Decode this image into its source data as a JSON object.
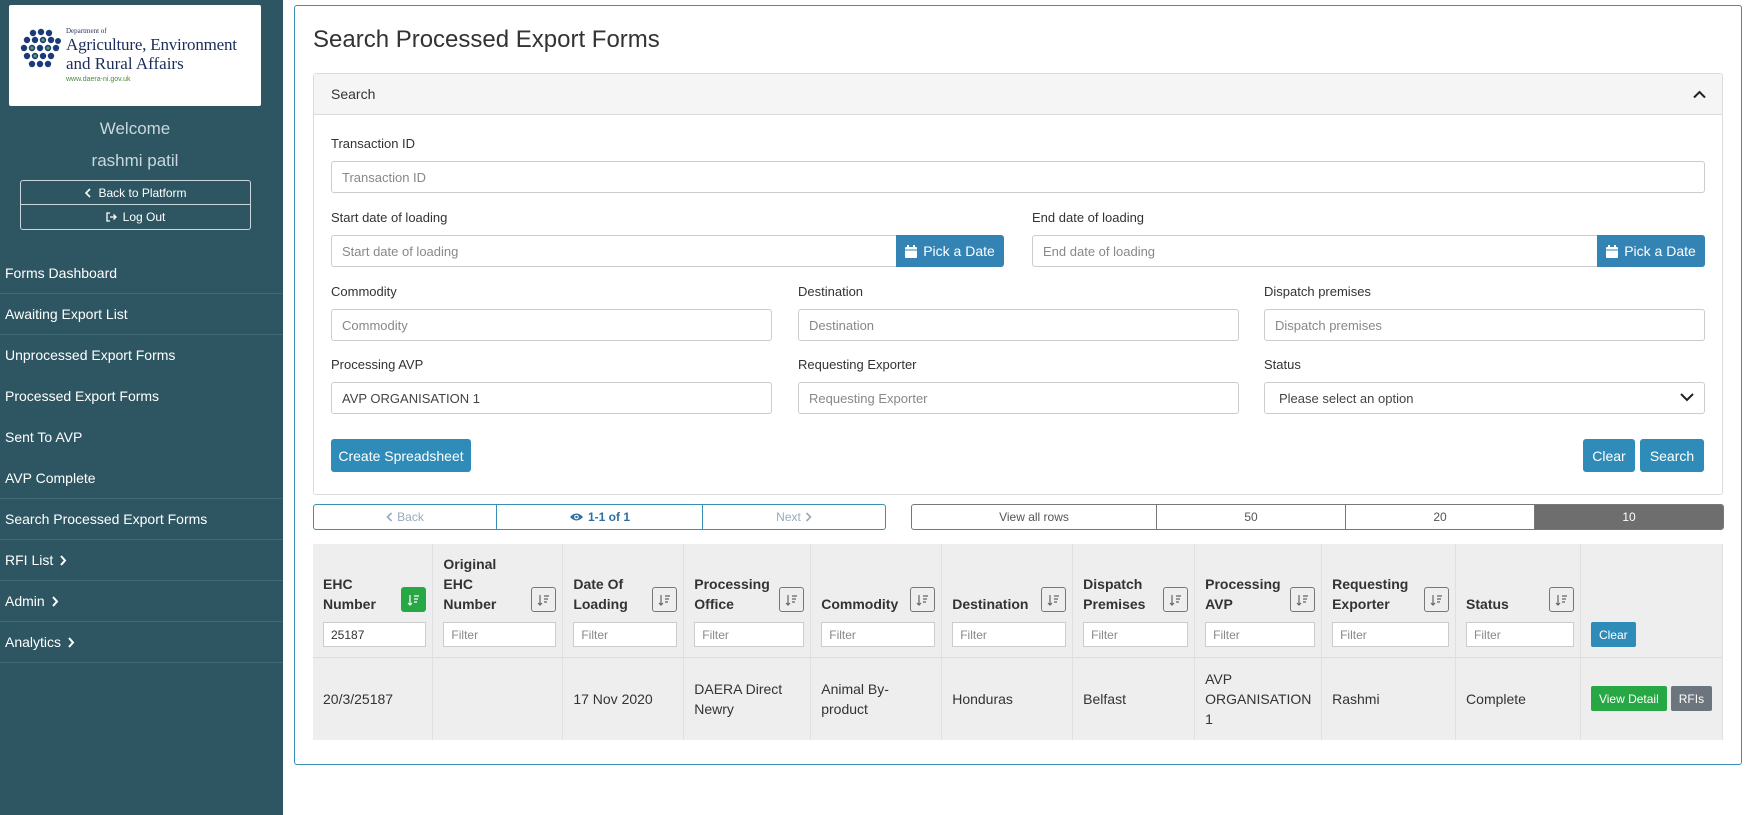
{
  "logo": {
    "dept": "Department of",
    "line1": "Agriculture, Environment",
    "line2": "and Rural Affairs",
    "url": "www.daera-ni.gov.uk"
  },
  "user": {
    "welcome": "Welcome",
    "name": "rashmi patil"
  },
  "sidebar_buttons": {
    "back": "Back to Platform",
    "logout": "Log Out"
  },
  "nav": [
    {
      "label": "Forms Dashboard"
    },
    {
      "label": "Awaiting Export List"
    },
    {
      "label": "Unprocessed Export Forms"
    },
    {
      "label": "Processed Export Forms"
    },
    {
      "label": "Sent To AVP"
    },
    {
      "label": "AVP Complete"
    },
    {
      "label": "Search Processed Export Forms"
    },
    {
      "label": "RFI List"
    },
    {
      "label": "Admin"
    },
    {
      "label": "Analytics"
    }
  ],
  "page": {
    "title": "Search Processed Export Forms"
  },
  "search": {
    "header": "Search",
    "transaction_id": {
      "label": "Transaction ID",
      "placeholder": "Transaction ID"
    },
    "start_date": {
      "label": "Start date of loading",
      "placeholder": "Start date of loading",
      "button": "Pick a Date"
    },
    "end_date": {
      "label": "End date of loading",
      "placeholder": "End date of loading",
      "button": "Pick a Date"
    },
    "commodity": {
      "label": "Commodity",
      "placeholder": "Commodity"
    },
    "destination": {
      "label": "Destination",
      "placeholder": "Destination"
    },
    "dispatch": {
      "label": "Dispatch premises",
      "placeholder": "Dispatch premises"
    },
    "processing_avp": {
      "label": "Processing AVP",
      "value": "AVP ORGANISATION 1"
    },
    "requesting_exporter": {
      "label": "Requesting Exporter",
      "placeholder": "Requesting Exporter"
    },
    "status": {
      "label": "Status",
      "value": "Please select an option"
    },
    "create_spreadsheet": "Create Spreadsheet",
    "clear": "Clear",
    "search": "Search"
  },
  "pagination": {
    "back": "Back",
    "info": "1-1 of 1",
    "next": "Next"
  },
  "rows_per_page": [
    "View all rows",
    "50",
    "20",
    "10"
  ],
  "table": {
    "headers": [
      {
        "l1": "EHC",
        "l2": "Number",
        "l3": ""
      },
      {
        "l1": "Original",
        "l2": "EHC",
        "l3": "Number"
      },
      {
        "l1": "Date Of",
        "l2": "Loading",
        "l3": ""
      },
      {
        "l1": "Processing",
        "l2": "Office",
        "l3": ""
      },
      {
        "l1": "Commodity",
        "l2": "",
        "l3": ""
      },
      {
        "l1": "Destination",
        "l2": "",
        "l3": ""
      },
      {
        "l1": "Dispatch",
        "l2": "Premises",
        "l3": ""
      },
      {
        "l1": "Processing",
        "l2": "AVP",
        "l3": ""
      },
      {
        "l1": "Requesting",
        "l2": "Exporter",
        "l3": ""
      },
      {
        "l1": "Status",
        "l2": "",
        "l3": ""
      }
    ],
    "filters": [
      "25187",
      "Filter",
      "Filter",
      "Filter",
      "Filter",
      "Filter",
      "Filter",
      "Filter",
      "Filter",
      "Filter"
    ],
    "filter_clear": "Clear",
    "row": {
      "ehc": "20/3/25187",
      "original": "",
      "date": "17 Nov 2020",
      "office": "DAERA Direct Newry",
      "commodity": "Animal By-product",
      "destination": "Honduras",
      "dispatch": "Belfast",
      "avp": "AVP ORGANISATION 1",
      "exporter": "Rashmi",
      "status": "Complete",
      "view": "View Detail",
      "rfis": "RFIs"
    }
  },
  "colors": {
    "sidebar": "#2d5562",
    "primary": "#2f8cb8",
    "success": "#28a745",
    "secondary": "#6c757d"
  }
}
